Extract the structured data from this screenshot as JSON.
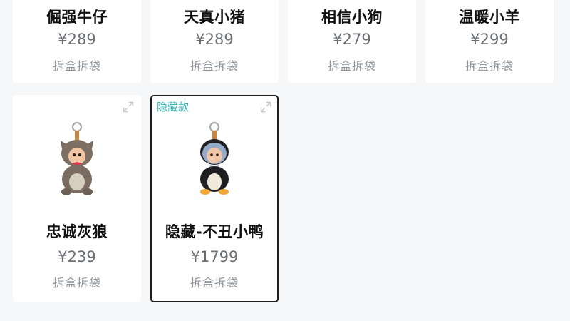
{
  "products": [
    {
      "name": "倔强牛仔",
      "price": "¥289",
      "action": "拆盒拆袋"
    },
    {
      "name": "天真小猪",
      "price": "¥289",
      "action": "拆盒拆袋"
    },
    {
      "name": "相信小狗",
      "price": "¥279",
      "action": "拆盒拆袋"
    },
    {
      "name": "温暖小羊",
      "price": "¥299",
      "action": "拆盒拆袋"
    },
    {
      "name": "忠诚灰狼",
      "price": "¥239",
      "action": "拆盒拆袋",
      "icon": "wolf-plush-keychain"
    },
    {
      "name": "隐藏-不丑小鸭",
      "price": "¥1799",
      "action": "拆盒拆袋",
      "tag": "隐藏款",
      "icon": "duck-plush-keychain",
      "selected": true
    }
  ],
  "colors": {
    "accent_tag": "#2bb5b1",
    "selected_border": "#1e1e1e",
    "price": "#6b6f75"
  }
}
